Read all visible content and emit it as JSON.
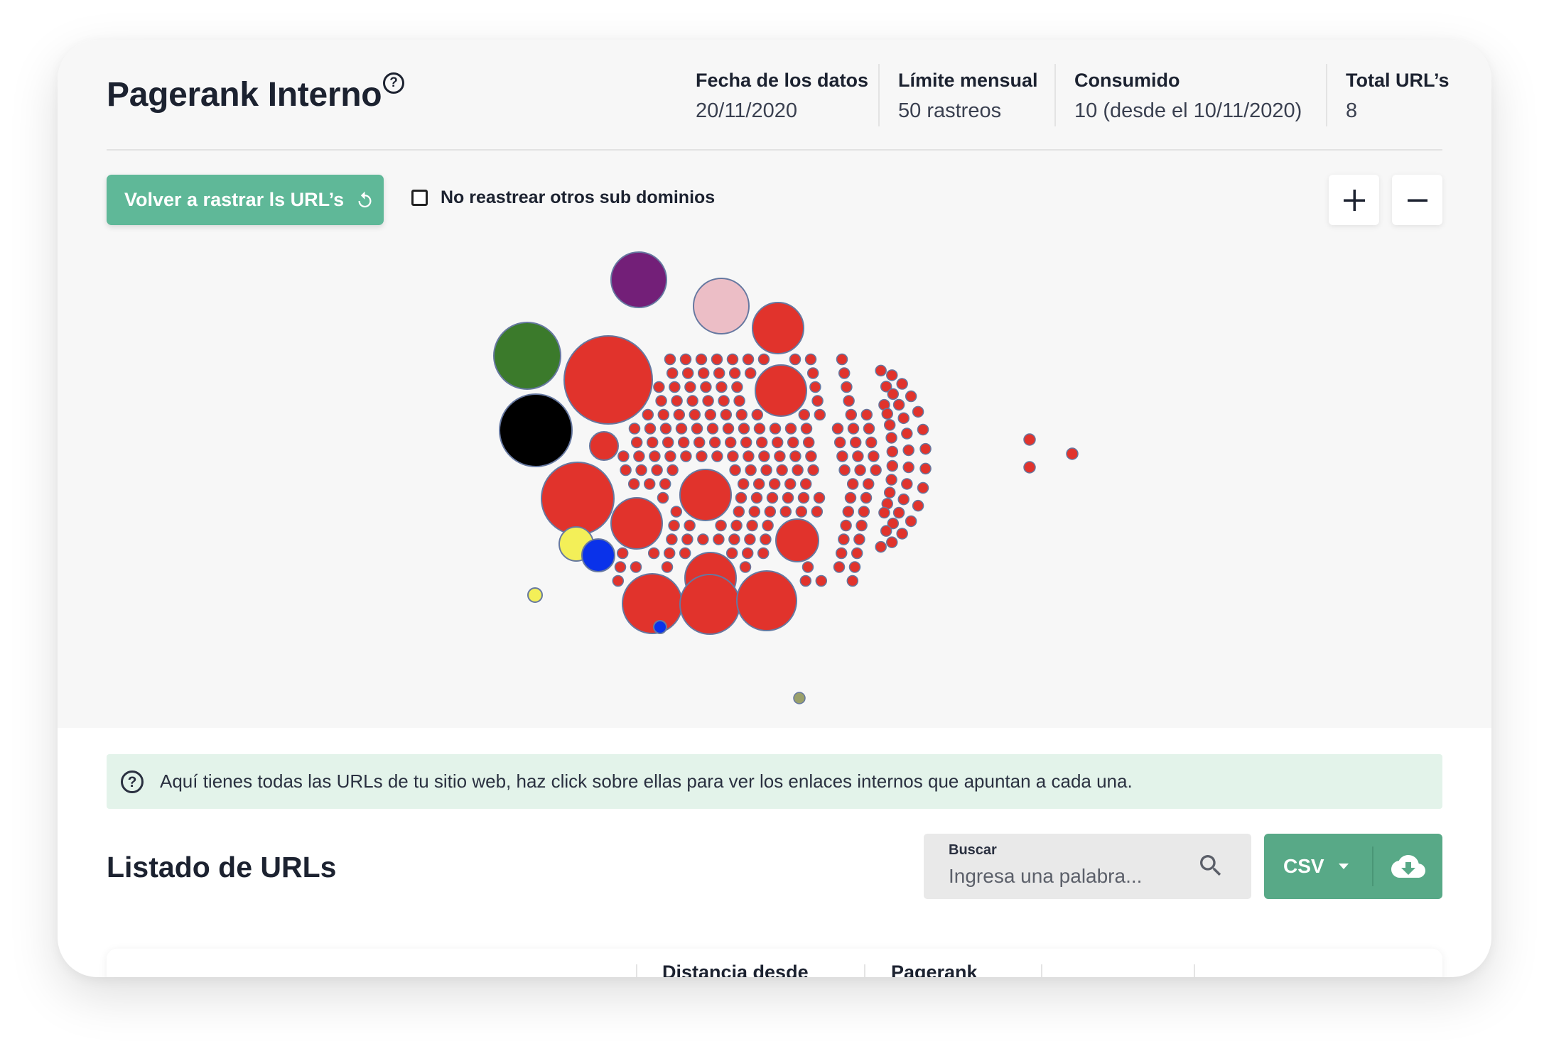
{
  "header": {
    "title": "Pagerank Interno",
    "help_icon": "question-circle-icon",
    "stats": [
      {
        "label": "Fecha de los datos",
        "value": "20/11/2020"
      },
      {
        "label": "Límite mensual",
        "value": "50 rastreos"
      },
      {
        "label": "Consumido",
        "value": "10 (desde el 10/11/2020)"
      },
      {
        "label": "Total URL’s",
        "value": "8"
      }
    ]
  },
  "toolbar": {
    "recrawl_label": "Volver a rastrar ls URL’s",
    "recrawl_icon": "refresh-icon",
    "no_subdomains_label": "No reastrear otros sub dominios",
    "no_subdomains_checked": false,
    "zoom_in_icon": "plus-icon",
    "zoom_out_icon": "minus-icon"
  },
  "graph": {
    "node_colors": {
      "default": "#e1332c",
      "purple": "#731f78",
      "pink": "#ecbec6",
      "green": "#3b7a2b",
      "black": "#000000",
      "yellow": "#f3ef58",
      "blue": "#0a32ea",
      "olive": "#9aa06a",
      "stroke": "#6678a0"
    }
  },
  "info": {
    "icon": "question-circle-icon",
    "text": "Aquí tienes todas las URLs de tu sitio web, haz click sobre ellas para ver los enlaces internos que apuntan a cada una."
  },
  "list": {
    "title": "Listado de URLs",
    "search": {
      "label": "Buscar",
      "placeholder": "Ingresa una palabra...",
      "value": "",
      "icon": "search-icon"
    },
    "export": {
      "format_label": "CSV",
      "caret_icon": "caret-down-icon",
      "download_icon": "cloud-download-icon"
    },
    "columns": [
      "",
      "Distancia desde",
      "Pagerank",
      "",
      ""
    ]
  },
  "colors": {
    "accent": "#5fb898",
    "accent_dark": "#58a987",
    "info_bg": "#e3f3ea",
    "text": "#1c2230"
  }
}
